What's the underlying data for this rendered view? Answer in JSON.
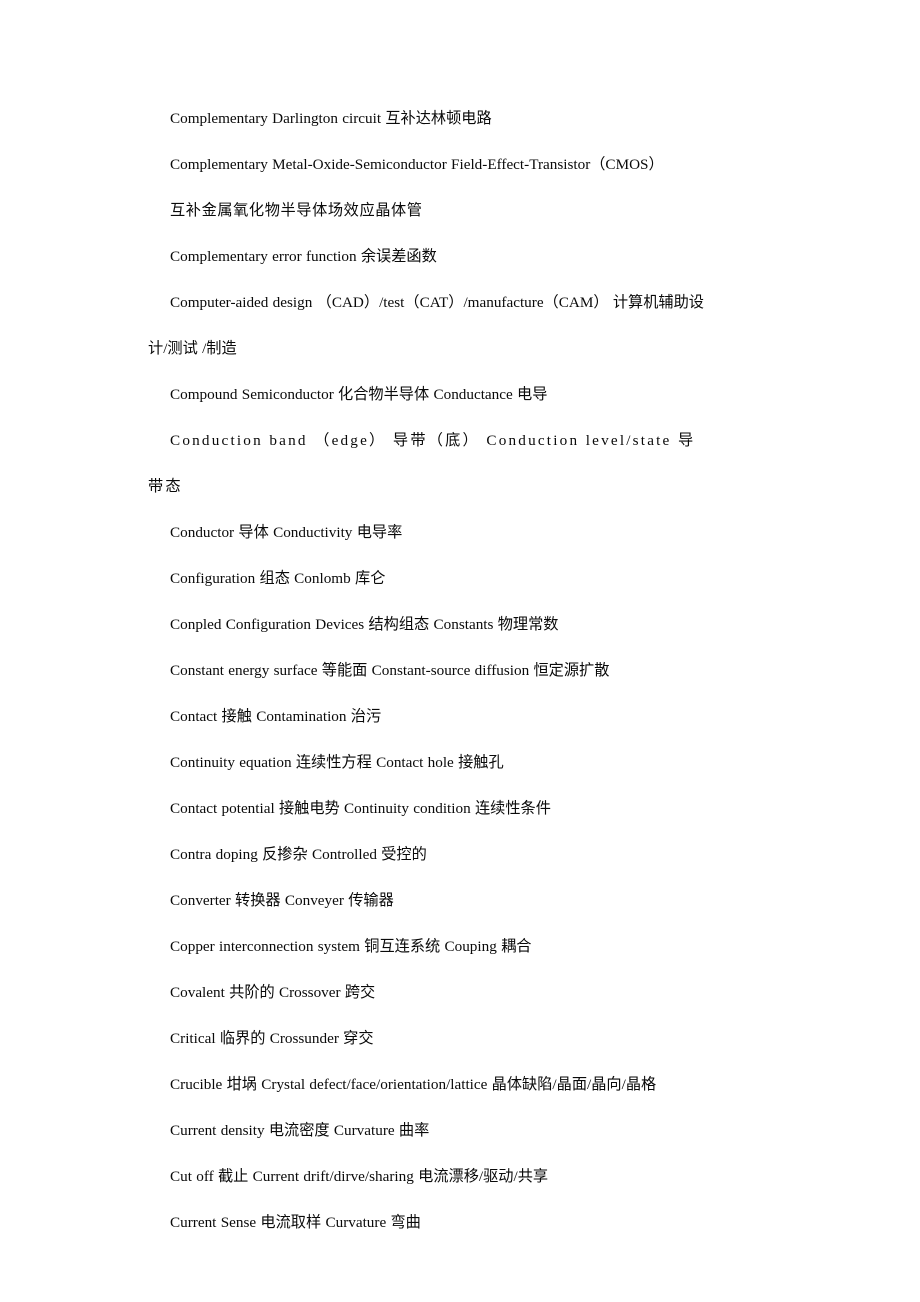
{
  "document": {
    "type": "glossary",
    "language_pair": "English-Chinese",
    "text_color": "#0a0a0a",
    "background_color": "#ffffff",
    "entries": [
      {
        "id": "complementary-darlington-circuit",
        "en": "Complementary Darlington circuit",
        "cn": "互补达林顿电路",
        "text": "Complementary Darlington circuit  互补达林顿电路"
      },
      {
        "id": "cmos",
        "en": "Complementary Metal-Oxide-Semiconductor Field-Effect-Transistor（CMOS）",
        "cn": "",
        "text": "Complementary Metal-Oxide-Semiconductor Field-Effect-Transistor（CMOS）"
      },
      {
        "id": "cmos-chinese",
        "en": "",
        "cn": "互补金属氧化物半导体场效应晶体管",
        "text": "互补金属氧化物半导体场效应晶体管"
      },
      {
        "id": "complementary-error-function",
        "en": "Complementary error function",
        "cn": "余误差函数",
        "text": "Complementary error function  余误差函数"
      },
      {
        "id": "computer-aided-design",
        "en": "Computer-aided design  （CAD）/test（CAT）/manufacture（CAM）",
        "cn": "计算机辅助设计/测试 /制造",
        "text": "Computer-aided design  （CAD）/test（CAT）/manufacture（CAM）  计算机辅助设计/测试 /制造"
      },
      {
        "id": "compound-semiconductor",
        "en": "Compound Semiconductor",
        "cn": "化合物半导体",
        "text": "Compound Semiconductor  化合物半导体  Conductance  电导"
      },
      {
        "id": "conduction-band",
        "en": "Conduction band （edge）",
        "cn": "导带（底）",
        "text": "Conduction band  （edge）  导带（底）  Conduction level/state  导带态"
      },
      {
        "id": "conductor",
        "en": "Conductor",
        "cn": "导体",
        "text": "Conductor  导体  Conductivity  电导率"
      },
      {
        "id": "configuration",
        "en": "Configuration",
        "cn": "组态",
        "text": "Configuration  组态  Conlomb  库仑"
      },
      {
        "id": "conpled-configuration-devices",
        "en": "Conpled Configuration Devices",
        "cn": "结构组态",
        "text": "Conpled Configuration Devices  结构组态  Constants  物理常数"
      },
      {
        "id": "constant-energy-surface",
        "en": "Constant energy surface",
        "cn": "等能面",
        "text": "Constant energy surface  等能面  Constant-source diffusion 恒定源扩散"
      },
      {
        "id": "contact",
        "en": "Contact",
        "cn": "接触",
        "text": "Contact  接触  Contamination  治污"
      },
      {
        "id": "continuity-equation",
        "en": "Continuity equation",
        "cn": "连续性方程",
        "text": "Continuity equation  连续性方程  Contact hole  接触孔"
      },
      {
        "id": "contact-potential",
        "en": "Contact potential",
        "cn": "接触电势",
        "text": "Contact potential  接触电势  Continuity condition  连续性条件"
      },
      {
        "id": "contra-doping",
        "en": "Contra doping",
        "cn": "反掺杂",
        "text": "Contra doping  反掺杂  Controlled  受控的"
      },
      {
        "id": "converter",
        "en": "Converter",
        "cn": "转换器",
        "text": "Converter  转换器  Conveyer  传输器"
      },
      {
        "id": "copper-interconnection-system",
        "en": "Copper interconnection system",
        "cn": "铜互连系统",
        "text": "Copper interconnection system  铜互连系统  Couping  耦合"
      },
      {
        "id": "covalent",
        "en": "Covalent",
        "cn": "共阶的",
        "text": "Covalent  共阶的  Crossover  跨交"
      },
      {
        "id": "critical",
        "en": "Critical",
        "cn": "临界的",
        "text": "Critical  临界的  Crossunder  穿交"
      },
      {
        "id": "crucible",
        "en": "Crucible",
        "cn": "坩埚",
        "text": "Crucible 坩埚  Crystal defect/face/orientation/lattice  晶体缺陷/晶面/晶向/晶格"
      },
      {
        "id": "current-density",
        "en": "Current density",
        "cn": "电流密度",
        "text": "Current density  电流密度  Curvature  曲率"
      },
      {
        "id": "cut-off",
        "en": "Cut off",
        "cn": "截止",
        "text": "Cut off  截止  Current drift/dirve/sharing  电流漂移/驱动/共享"
      },
      {
        "id": "current-sense",
        "en": "Current Sense",
        "cn": "电流取样",
        "text": "Current Sense  电流取样  Curvature  弯曲"
      }
    ]
  }
}
